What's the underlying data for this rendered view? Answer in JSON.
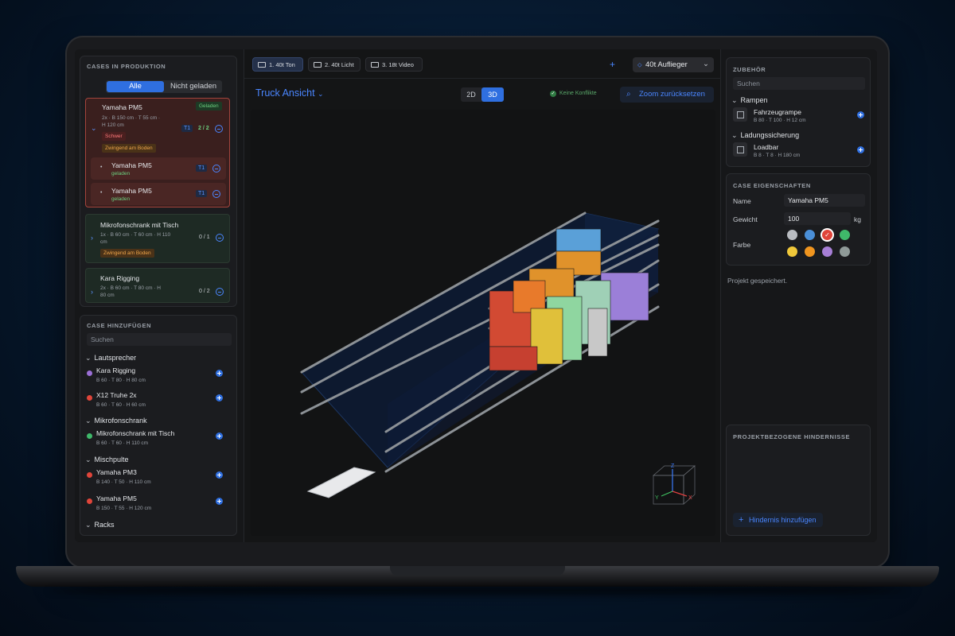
{
  "colors": {
    "accent": "#2f6fe0",
    "panel": "#1b1c1f",
    "background": "#071a30"
  },
  "left": {
    "production": {
      "title": "CASES IN PRODUKTION",
      "filter_all": "Alle",
      "filter_not_loaded": "Nicht geladen",
      "cases": [
        {
          "name": "Yamaha PM5",
          "dims_line1": "2x · B 150 cm · T 55 cm ·",
          "dims_line2": "H 120 cm",
          "status": "Geladen",
          "tag_heavy": "Schwer",
          "tag_floor": "Zwingend am Boden",
          "truck": "T1",
          "count": "2 / 2",
          "children": [
            {
              "name": "Yamaha PM5",
              "status": "geladen",
              "truck": "T1"
            },
            {
              "name": "Yamaha PM5",
              "status": "geladen",
              "truck": "T1"
            }
          ]
        },
        {
          "name": "Mikrofonschrank mit Tisch",
          "dims_line1": "1x · B 60 cm · T 60 cm · H 110",
          "dims_line2": "cm",
          "tag_floor": "Zwingend am Boden",
          "count": "0 / 1"
        },
        {
          "name": "Kara Rigging",
          "dims_line1": "2x · B 60 cm · T 80 cm · H",
          "dims_line2": "80 cm",
          "count": "0 / 2"
        }
      ]
    },
    "add_case": {
      "title": "CASE HINZUFÜGEN",
      "search_placeholder": "Suchen",
      "groups": [
        {
          "label": "Lautsprecher"
        },
        {
          "label": "Mikrofonschrank"
        },
        {
          "label": "Mischpulte"
        },
        {
          "label": "Racks"
        }
      ],
      "items": [
        {
          "name": "Kara Rigging",
          "dims": "B 60 · T 80 · H 80 cm",
          "color": "#9b6fd6"
        },
        {
          "name": "X12 Truhe 2x",
          "dims": "B 60 · T 60 · H 60 cm",
          "color": "#e0453a"
        },
        {
          "name": "Mikrofonschrank mit Tisch",
          "dims": "B 60 · T 60 · H 110 cm",
          "color": "#3fb86a"
        },
        {
          "name": "Yamaha PM3",
          "dims": "B 140 · T 50 · H 110 cm",
          "color": "#e0453a"
        },
        {
          "name": "Yamaha PM5",
          "dims": "B 150 · T 55 · H 120 cm",
          "color": "#e0453a"
        }
      ]
    }
  },
  "center": {
    "tabs": [
      {
        "label": "1. 40t Ton"
      },
      {
        "label": "2. 40t Licht"
      },
      {
        "label": "3. 18t Video"
      }
    ],
    "add_label": "+",
    "truck_type": "40t Auflieger",
    "view_title": "Truck Ansicht",
    "view_2d": "2D",
    "view_3d": "3D",
    "conflicts": "Keine Konflikte",
    "reset_zoom": "Zoom zurücksetzen",
    "axis": {
      "x": "X",
      "y": "Y",
      "z": "Z"
    }
  },
  "right": {
    "accessories": {
      "title": "ZUBEHÖR",
      "search_placeholder": "Suchen",
      "groups": [
        {
          "label": "Rampen",
          "item": {
            "name": "Fahrzeugrampe",
            "dims": "B 80 · T 100 · H 12 cm"
          }
        },
        {
          "label": "Ladungssicherung",
          "item": {
            "name": "Loadbar",
            "dims": "B 8 · T 8 · H 180 cm"
          }
        }
      ]
    },
    "properties": {
      "title": "CASE EIGENSCHAFTEN",
      "name_label": "Name",
      "name_value": "Yamaha PM5",
      "weight_label": "Gewicht",
      "weight_value": "100",
      "weight_unit": "kg",
      "color_label": "Farbe",
      "swatches": [
        "#b9bcc1",
        "#4a8fd8",
        "#e0453a",
        "#3fb86a",
        "#f0c83a",
        "#f0951f",
        "#a77fd6",
        "#8f9a98"
      ],
      "selected_swatch": 2
    },
    "status": "Projekt gespeichert.",
    "obstacles": {
      "title": "PROJEKTBEZOGENE HINDERNISSE",
      "add_label": "Hindernis hinzufügen"
    }
  }
}
